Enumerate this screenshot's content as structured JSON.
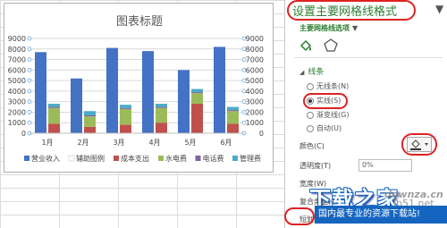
{
  "chart_data": {
    "type": "bar",
    "title": "图表标题",
    "categories": [
      "1月",
      "2月",
      "3月",
      "4月",
      "5月",
      "6月"
    ],
    "ylim": [
      0,
      9000
    ],
    "yticks": [
      0,
      1000,
      2000,
      3000,
      4000,
      5000,
      6000,
      7000,
      8000,
      9000
    ],
    "series": [
      {
        "name": "营业收入",
        "color": "#4472c4",
        "values": [
          7700,
          5200,
          8100,
          7800,
          6000,
          8200
        ]
      },
      {
        "name": "辅助图例",
        "color": "#ffffff",
        "values": [
          0,
          0,
          0,
          0,
          0,
          0
        ]
      },
      {
        "name": "成本支出",
        "color": "#c0504d",
        "values": [
          900,
          600,
          800,
          1000,
          2800,
          900
        ]
      },
      {
        "name": "水电费",
        "color": "#9bbb59",
        "values": [
          1500,
          1000,
          1500,
          1400,
          1000,
          1200
        ]
      },
      {
        "name": "电话费",
        "color": "#8064a2",
        "values": [
          100,
          100,
          100,
          100,
          100,
          100
        ]
      },
      {
        "name": "管理费",
        "color": "#4bacc6",
        "values": [
          300,
          400,
          300,
          300,
          300,
          300
        ]
      }
    ],
    "grid": true,
    "legend_position": "bottom"
  },
  "panel": {
    "title": "设置主要网格线格式",
    "close": "▼",
    "subtitle": "主要网格线选项",
    "section": "线条",
    "options": [
      "无线条(N)",
      "实线(S)",
      "渐变线(G)",
      "自动(U)"
    ],
    "selected_option": "实线(S)",
    "labels": [
      "颜色(C)",
      "透明度(T)",
      "宽度(W)",
      "复合类型(C)",
      "短划线类型(D)"
    ],
    "transparency_value": "0%",
    "watermark_cn": "下载之家",
    "watermark_site": "downza.cn",
    "watermark_ib": "ib51.net",
    "watermark_bar": "国内最专业的资源下载站!"
  }
}
